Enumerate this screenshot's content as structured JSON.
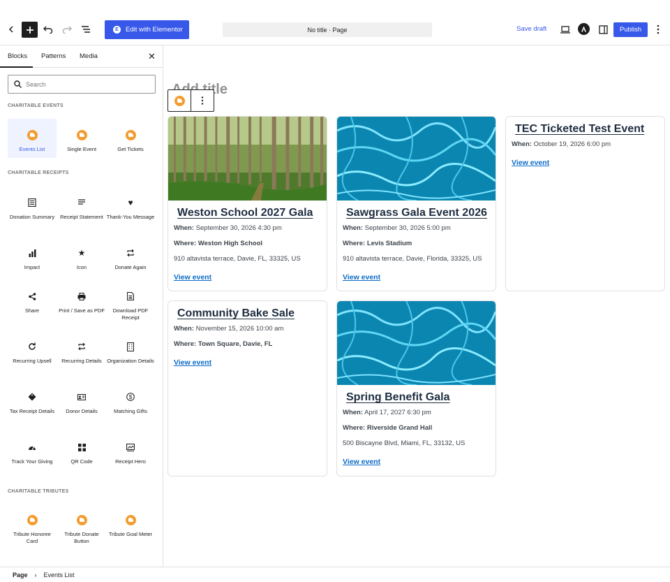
{
  "toolbar": {
    "elementor_label": "Edit with Elementor",
    "document_title": "No title · Page",
    "save_draft_label": "Save draft",
    "publish_label": "Publish"
  },
  "sidebar": {
    "tabs": [
      "Blocks",
      "Patterns",
      "Media"
    ],
    "search_placeholder": "Search",
    "categories": [
      {
        "title": "CHARITABLE EVENTS",
        "blocks": [
          "Events List",
          "Single Event",
          "Get Tickets"
        ]
      },
      {
        "title": "CHARITABLE RECEIPTS",
        "blocks": [
          "Donation Summary",
          "Receipt Statement",
          "Thank-You Message",
          "Impact",
          "Icon",
          "Donate Again",
          "Share",
          "Print / Save as PDF",
          "Download PDF Receipt",
          "Recurring Upsell",
          "Recurring Details",
          "Organization Details",
          "Tax Receipt Details",
          "Donor Details",
          "Matching Gifts",
          "Track Your Giving",
          "QR Code",
          "Receipt Hero"
        ]
      },
      {
        "title": "CHARITABLE TRIBUTES",
        "blocks": [
          "Tribute Honoree Card",
          "Tribute Donate Button",
          "Tribute Goal Meter"
        ]
      }
    ]
  },
  "canvas": {
    "title_placeholder": "Add title",
    "events": [
      {
        "title": "Weston School 2027 Gala",
        "when_label": "When:",
        "when": "September 30, 2026 4:30 pm",
        "where_label": "Where:",
        "where": "Weston High School",
        "address": "910 altavista terrace, Davie, FL, 33325, US",
        "link": "View event",
        "image": "forest"
      },
      {
        "title": "Sawgrass Gala Event 2026",
        "when_label": "When:",
        "when": "September 30, 2026 5:00 pm",
        "where_label": "Where:",
        "where": "Levis Stadium",
        "address": "910 altavista terrace, Davie, Florida, 33325, US",
        "link": "View event",
        "image": "water"
      },
      {
        "title": "TEC Ticketed Test Event",
        "when_label": "When:",
        "when": "October 19, 2026 6:00 pm",
        "link": "View event"
      },
      {
        "title": "Community Bake Sale",
        "when_label": "When:",
        "when": "November 15, 2026 10:00 am",
        "where_label": "Where:",
        "where": "Town Square, Davie, FL",
        "link": "View event"
      },
      {
        "title": "Spring Benefit Gala",
        "when_label": "When:",
        "when": "April 17, 2027 6:30 pm",
        "where_label": "Where:",
        "where": "Riverside Grand Hall",
        "address": "500 Biscayne Blvd, Miami, FL, 33132, US",
        "link": "View event",
        "image": "water"
      }
    ]
  },
  "footer": {
    "breadcrumb": [
      "Page",
      "Events List"
    ]
  },
  "colors": {
    "accent": "#3858e9",
    "plugin_orange": "#f39c32",
    "link": "#0b6bc8"
  }
}
